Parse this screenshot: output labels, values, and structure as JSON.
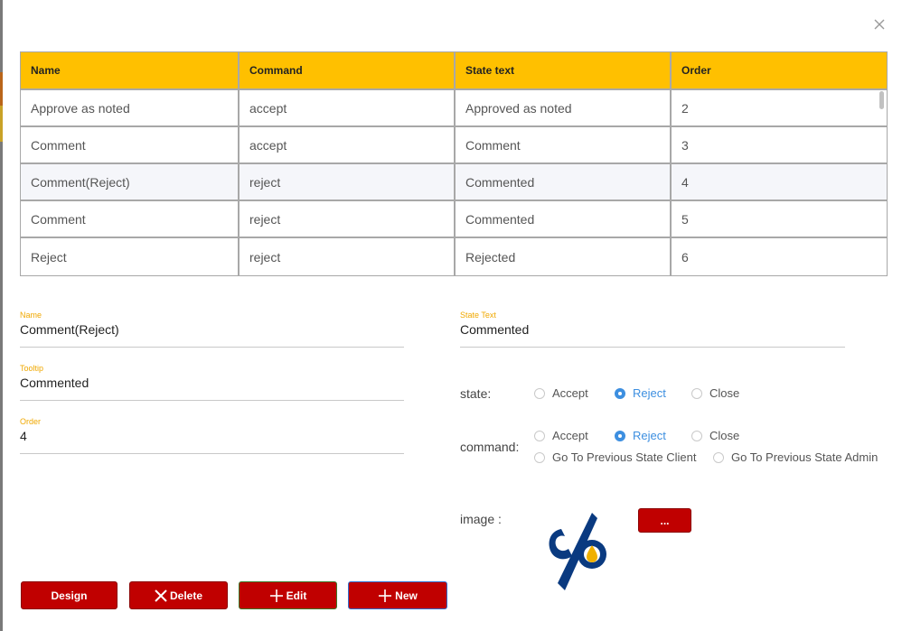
{
  "table": {
    "headers": [
      "Name",
      "Command",
      "State text",
      "Order"
    ],
    "rows": [
      [
        "Approve as noted",
        "accept",
        "Approved as noted",
        "2"
      ],
      [
        "Comment",
        "accept",
        "Comment",
        "3"
      ],
      [
        "Comment(Reject)",
        "reject",
        "Commented",
        "4"
      ],
      [
        "Comment",
        "reject",
        "Commented",
        "5"
      ],
      [
        "Reject",
        "reject",
        "Rejected",
        "6"
      ]
    ],
    "selected_row": 2
  },
  "form": {
    "name": {
      "label": "Name",
      "value": "Comment(Reject)"
    },
    "tooltip": {
      "label": "Tooltip",
      "value": "Commented"
    },
    "order": {
      "label": "Order",
      "value": "4"
    },
    "state_text": {
      "label": "State Text",
      "value": "Commented"
    },
    "state": {
      "label": "state:",
      "options": [
        "Accept",
        "Reject",
        "Close"
      ],
      "selected": "Reject"
    },
    "command": {
      "label": "command:",
      "options": [
        "Accept",
        "Reject",
        "Close",
        "Go To Previous State Client",
        "Go To Previous State Admin"
      ],
      "selected": "Reject"
    },
    "image": {
      "label": "image :",
      "browse_label": "..."
    }
  },
  "buttons": {
    "design": "Design",
    "delete": "Delete",
    "edit": "Edit",
    "new": "New"
  },
  "colors": {
    "header_bg": "#ffc000",
    "button_bg": "#c00000",
    "radio_selected": "#3d8fe0",
    "field_label": "#f0a800",
    "logo_blue": "#0a3a80",
    "logo_gold": "#f0b000"
  },
  "icons": {
    "close": "close-icon",
    "delete": "x-icon",
    "edit": "plus-icon",
    "new": "plus-icon",
    "image": "company-logo"
  }
}
